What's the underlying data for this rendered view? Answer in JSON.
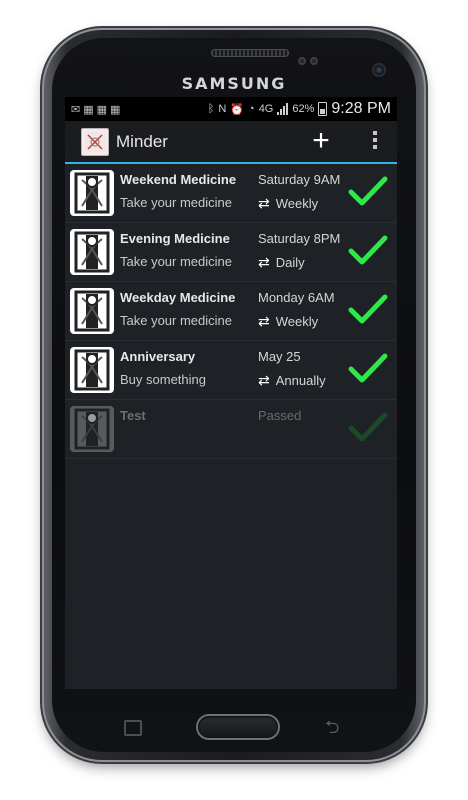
{
  "device": {
    "brand": "SAMSUNG"
  },
  "status_bar": {
    "time": "9:28 PM",
    "battery_percent": "62%",
    "network": "4G",
    "icons": [
      "mail-icon",
      "calendar-icon",
      "calendar-icon",
      "calendar-icon",
      "bluetooth-icon",
      "nfc-icon",
      "alarm-icon",
      "wifi-icon",
      "signal-icon",
      "battery-icon"
    ]
  },
  "action_bar": {
    "title": "Minder",
    "add_label": "+",
    "overflow_label": "More options"
  },
  "reminders": [
    {
      "title": "Weekend Medicine",
      "subtitle": "Take your medicine",
      "when": "Saturday 9AM",
      "repeat": "Weekly",
      "state": "active"
    },
    {
      "title": "Evening Medicine",
      "subtitle": "Take your medicine",
      "when": "Saturday 8PM",
      "repeat": "Daily",
      "state": "active"
    },
    {
      "title": "Weekday Medicine",
      "subtitle": "Take your medicine",
      "when": "Monday 6AM",
      "repeat": "Weekly",
      "state": "active"
    },
    {
      "title": "Anniversary",
      "subtitle": "Buy something",
      "when": "May 25",
      "repeat": "Annually",
      "state": "active"
    },
    {
      "title": "Test",
      "subtitle": "",
      "when": "Passed",
      "repeat": "",
      "state": "passed"
    }
  ],
  "colors": {
    "accent": "#33b5e5",
    "check": "#2ee84a",
    "check_passed": "#1f7a2c",
    "screen_bg": "#1e2125"
  }
}
